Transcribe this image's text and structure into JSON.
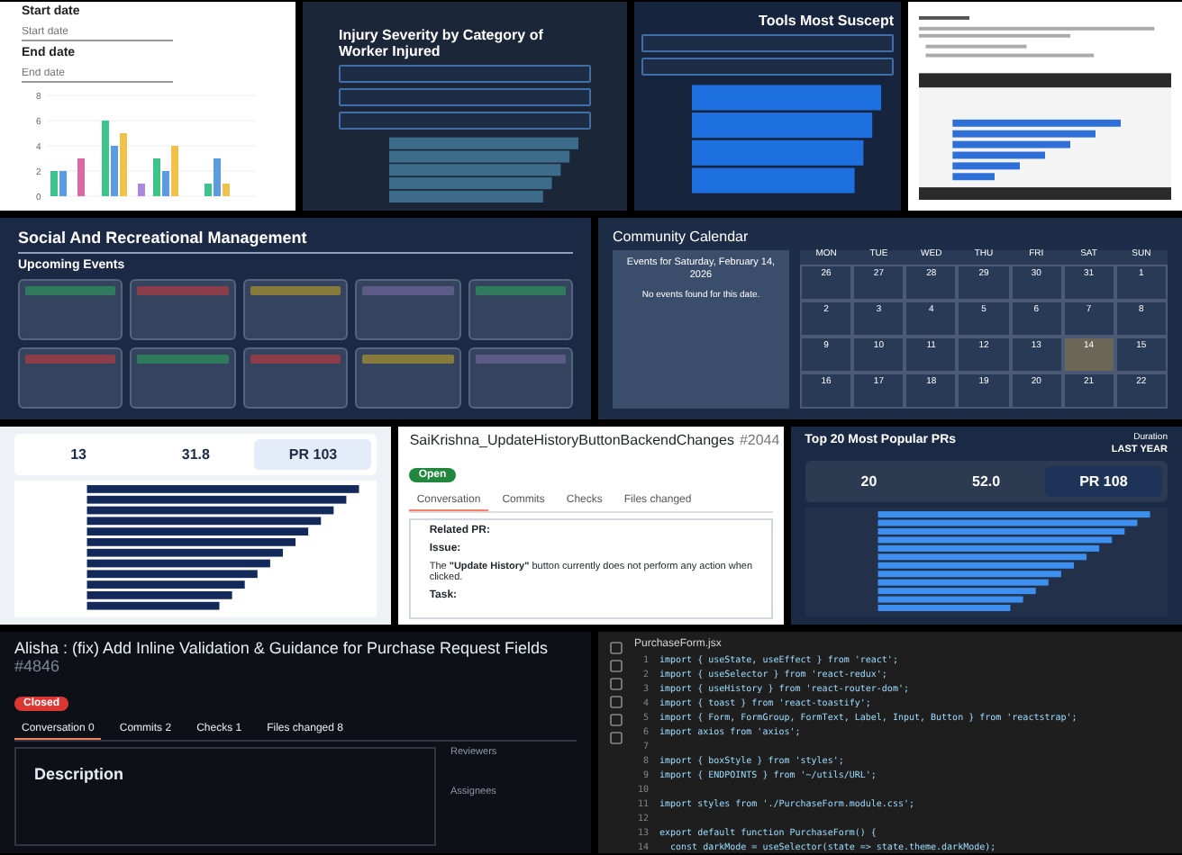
{
  "rows": [
    {
      "panels": [
        {
          "kind": "filter_chart",
          "fields": [
            {
              "label": "Start date",
              "placeholder": "Start date"
            },
            {
              "label": "End date",
              "placeholder": "End date"
            }
          ],
          "chart_data": {
            "type": "bar",
            "grid": true,
            "yticks": [
              0,
              2,
              4,
              6,
              8
            ],
            "ylim": [
              0,
              8
            ],
            "series": [
              {
                "color": "#3cc48a",
                "values": [
                  2,
                  6,
                  3,
                  1
                ]
              },
              {
                "color": "#5b9be0",
                "values": [
                  2,
                  4,
                  2,
                  3
                ]
              },
              {
                "color": "#f0c24a",
                "values": [
                  null,
                  5,
                  4,
                  1
                ]
              },
              {
                "color": "#d96aa8",
                "values": [
                  3,
                  null,
                  null,
                  null
                ]
              },
              {
                "color": "#a98ae0",
                "values": [
                  null,
                  1,
                  null,
                  null
                ]
              }
            ]
          }
        },
        {
          "kind": "dark_filters",
          "title": "Injury Severity by Category of Worker Injured"
        },
        {
          "kind": "tools_chart",
          "title": "Tools Most Suscept"
        },
        {
          "kind": "doc_screenshot"
        }
      ]
    },
    {
      "panels": [
        {
          "kind": "events",
          "title": "Social And Recreational Management",
          "subtitle": "Upcoming Events",
          "cards": [
            {
              "color": "#2f7a5c"
            },
            {
              "color": "#8c3d4a"
            },
            {
              "color": "#867a3c"
            },
            {
              "color": "#5c5b88"
            },
            {
              "color": "#2f7a5c"
            },
            {
              "color": "#8c3d4a"
            },
            {
              "color": "#2f7a5c"
            },
            {
              "color": "#8c3d4a"
            },
            {
              "color": "#867a3c"
            },
            {
              "color": "#5c5b88"
            }
          ]
        },
        {
          "kind": "calendar",
          "title": "Community Calendar",
          "events_heading": "Events for Saturday, February 14, 2026",
          "empty_text": "No events found for this date.",
          "weekdays": [
            "MON",
            "TUE",
            "WED",
            "THU",
            "FRI",
            "SAT",
            "SUN"
          ],
          "days": [
            {
              "label": "26",
              "selected": false
            },
            {
              "label": "27",
              "selected": false
            },
            {
              "label": "28",
              "selected": false
            },
            {
              "label": "29",
              "selected": false
            },
            {
              "label": "30",
              "selected": false
            },
            {
              "label": "31",
              "selected": false
            },
            {
              "label": "1",
              "selected": false
            },
            {
              "label": "2",
              "selected": false
            },
            {
              "label": "3",
              "selected": false
            },
            {
              "label": "4",
              "selected": false
            },
            {
              "label": "5",
              "selected": false
            },
            {
              "label": "6",
              "selected": false
            },
            {
              "label": "7",
              "selected": false
            },
            {
              "label": "8",
              "selected": false
            },
            {
              "label": "9",
              "selected": false
            },
            {
              "label": "10",
              "selected": false
            },
            {
              "label": "11",
              "selected": false
            },
            {
              "label": "12",
              "selected": false
            },
            {
              "label": "13",
              "selected": false
            },
            {
              "label": "14",
              "selected": true
            },
            {
              "label": "15",
              "selected": false
            },
            {
              "label": "16",
              "selected": false
            },
            {
              "label": "17",
              "selected": false
            },
            {
              "label": "18",
              "selected": false
            },
            {
              "label": "19",
              "selected": false
            },
            {
              "label": "20",
              "selected": false
            },
            {
              "label": "21",
              "selected": false
            },
            {
              "label": "22",
              "selected": false
            }
          ]
        }
      ]
    },
    {
      "panels": [
        {
          "kind": "stats_light",
          "stats": [
            {
              "value": "13",
              "selected": false
            },
            {
              "value": "31.8",
              "selected": false
            },
            {
              "value": "PR 103",
              "selected": true
            }
          ]
        },
        {
          "kind": "pr_light",
          "title": "SaiKrishna_UpdateHistoryButtonBackendChanges",
          "number": "#2044",
          "status": "Open",
          "tabs": [
            {
              "label": "Conversation",
              "selected": true
            },
            {
              "label": "Commits",
              "selected": false
            },
            {
              "label": "Checks",
              "selected": false
            },
            {
              "label": "Files changed",
              "selected": false
            }
          ],
          "related": "Related PR:",
          "issue_heading": "Issue:",
          "issue_text": "The **\"Update History\"** button currently does not perform any action when clicked.",
          "task_heading": "Task:"
        },
        {
          "kind": "stats_dark",
          "title": "Top 20 Most Popular PRs",
          "duration_label": "Duration",
          "duration": "LAST YEAR",
          "stats": [
            {
              "value": "20",
              "selected": false
            },
            {
              "value": "52.0",
              "selected": false
            },
            {
              "value": "PR 108",
              "selected": true
            }
          ]
        }
      ]
    },
    {
      "panels": [
        {
          "kind": "pr_dark",
          "title": "Alisha : (fix) Add Inline Validation & Guidance for Purchase Request Fields",
          "number": "#4846",
          "status": "Closed",
          "tabs": [
            {
              "label": "Conversation",
              "count": "0",
              "selected": true
            },
            {
              "label": "Commits",
              "count": "2",
              "selected": false
            },
            {
              "label": "Checks",
              "count": "1",
              "selected": false
            },
            {
              "label": "Files changed",
              "count": "8",
              "selected": false
            }
          ],
          "heading": "Description",
          "sidebar": [
            "Reviewers",
            "Assignees"
          ]
        },
        {
          "kind": "code",
          "file": "PurchaseForm.jsx",
          "lines": [
            {
              "number": "1",
              "code": "import { useState, useEffect } from 'react';"
            },
            {
              "number": "2",
              "code": "import { useSelector } from 'react-redux';"
            },
            {
              "number": "3",
              "code": "import { useHistory } from 'react-router-dom';"
            },
            {
              "number": "4",
              "code": "import { toast } from 'react-toastify';"
            },
            {
              "number": "5",
              "code": "import { Form, FormGroup, FormText, Label, Input, Button } from 'reactstrap';"
            },
            {
              "number": "6",
              "code": "import axios from 'axios';"
            },
            {
              "number": "7"
            },
            {
              "number": "8",
              "code": "import { boxStyle } from 'styles';"
            },
            {
              "number": "9",
              "code": "import { ENDPOINTS } from '~/utils/URL';"
            },
            {
              "number": "10"
            },
            {
              "number": "11",
              "code": "import styles from './PurchaseForm.module.css';"
            },
            {
              "number": "12"
            },
            {
              "number": "13",
              "code": "export default function PurchaseForm() {"
            },
            {
              "number": "14",
              "code": "  const darkMode = useSelector(state => state.theme.darkMode);"
            }
          ]
        }
      ]
    }
  ]
}
